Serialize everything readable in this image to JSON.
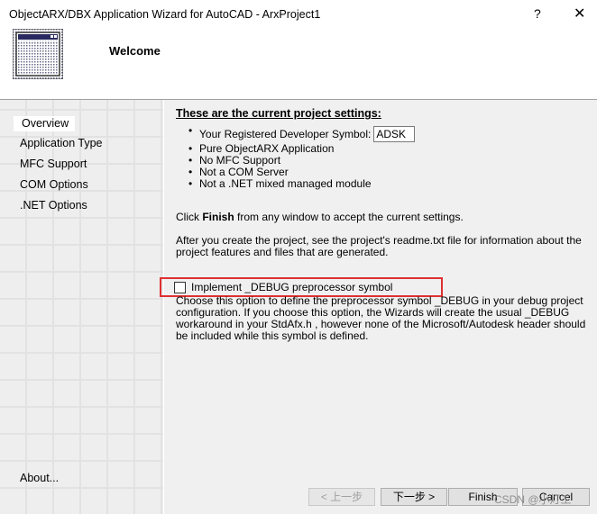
{
  "window": {
    "title": "ObjectARX/DBX Application Wizard for AutoCAD - ArxProject1",
    "help": "?",
    "close": "✕"
  },
  "header": {
    "title": "Welcome",
    "icon": "wizard-window-icon"
  },
  "sidebar": {
    "items": [
      {
        "label": "Overview",
        "active": true
      },
      {
        "label": "Application Type"
      },
      {
        "label": "MFC Support"
      },
      {
        "label": "COM Options"
      },
      {
        "label": ".NET Options"
      }
    ],
    "about": "About..."
  },
  "main": {
    "heading": "These are the current project settings:",
    "settings": {
      "dev_symbol_label": "Your Registered Developer Symbol:",
      "dev_symbol_value": "ADSK",
      "items": [
        "Pure ObjectARX Application",
        "No MFC Support",
        "Not a COM Server",
        "Not a .NET mixed managed module"
      ]
    },
    "finish_text": {
      "pre": "Click ",
      "bold": "Finish",
      "post": " from any window to accept the current settings."
    },
    "after_text": "After you create the project, see the project's readme.txt file for information about the project features and files that are generated.",
    "debug_checkbox": {
      "label": "Implement _DEBUG preprocessor symbol",
      "checked": false
    },
    "debug_description": "Choose this option to define the preprocessor symbol _DEBUG in your debug project configuration. If you choose this option, the Wizards will create the usual _DEBUG workaround in your StdAfx.h , however none of the Microsoft/Autodesk header should be included while this symbol is defined."
  },
  "buttons": {
    "back": "< 上一步",
    "next": "下一步 >",
    "finish": "Finish",
    "cancel": "Cancel"
  },
  "watermark": "CSDN @小灯工",
  "colors": {
    "highlight_border": "#e03030"
  }
}
